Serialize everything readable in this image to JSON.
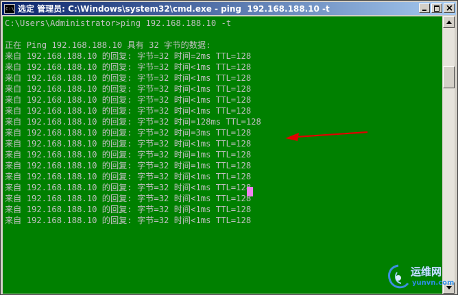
{
  "window": {
    "title": "选定 管理员: C:\\Windows\\system32\\cmd.exe - ping  192.168.188.10 -t",
    "icon_label": "C:\\"
  },
  "console": {
    "lines": [
      "C:\\Users\\Administrator>ping 192.168.188.10 -t",
      "",
      "正在 Ping 192.168.188.10 具有 32 字节的数据:",
      "来自 192.168.188.10 的回复: 字节=32 时间=2ms TTL=128",
      "来自 192.168.188.10 的回复: 字节=32 时间<1ms TTL=128",
      "来自 192.168.188.10 的回复: 字节=32 时间<1ms TTL=128",
      "来自 192.168.188.10 的回复: 字节=32 时间<1ms TTL=128",
      "来自 192.168.188.10 的回复: 字节=32 时间<1ms TTL=128",
      "来自 192.168.188.10 的回复: 字节=32 时间<1ms TTL=128",
      "来自 192.168.188.10 的回复: 字节=32 时间=128ms TTL=128",
      "来自 192.168.188.10 的回复: 字节=32 时间=3ms TTL=128",
      "来自 192.168.188.10 的回复: 字节=32 时间<1ms TTL=128",
      "来自 192.168.188.10 的回复: 字节=32 时间=1ms TTL=128",
      "来自 192.168.188.10 的回复: 字节=32 时间=1ms TTL=128",
      "来自 192.168.188.10 的回复: 字节=32 时间<1ms TTL=128",
      "来自 192.168.188.10 的回复: 字节=32 时间<1ms TTL=128",
      "来自 192.168.188.10 的回复: 字节=32 时间<1ms TTL=128",
      "来自 192.168.188.10 的回复: 字节=32 时间<1ms TTL=128",
      "来自 192.168.188.10 的回复: 字节=32 时间<1ms TTL=128"
    ],
    "text_color": "#c0c0c0",
    "background_color": "#008000",
    "cursor_color": "#ee82ee"
  },
  "annotation": {
    "arrow_color": "#e00000",
    "icon": "red-arrow-icon"
  },
  "watermark": {
    "brand": "运维网",
    "url": "yunvn.com"
  }
}
